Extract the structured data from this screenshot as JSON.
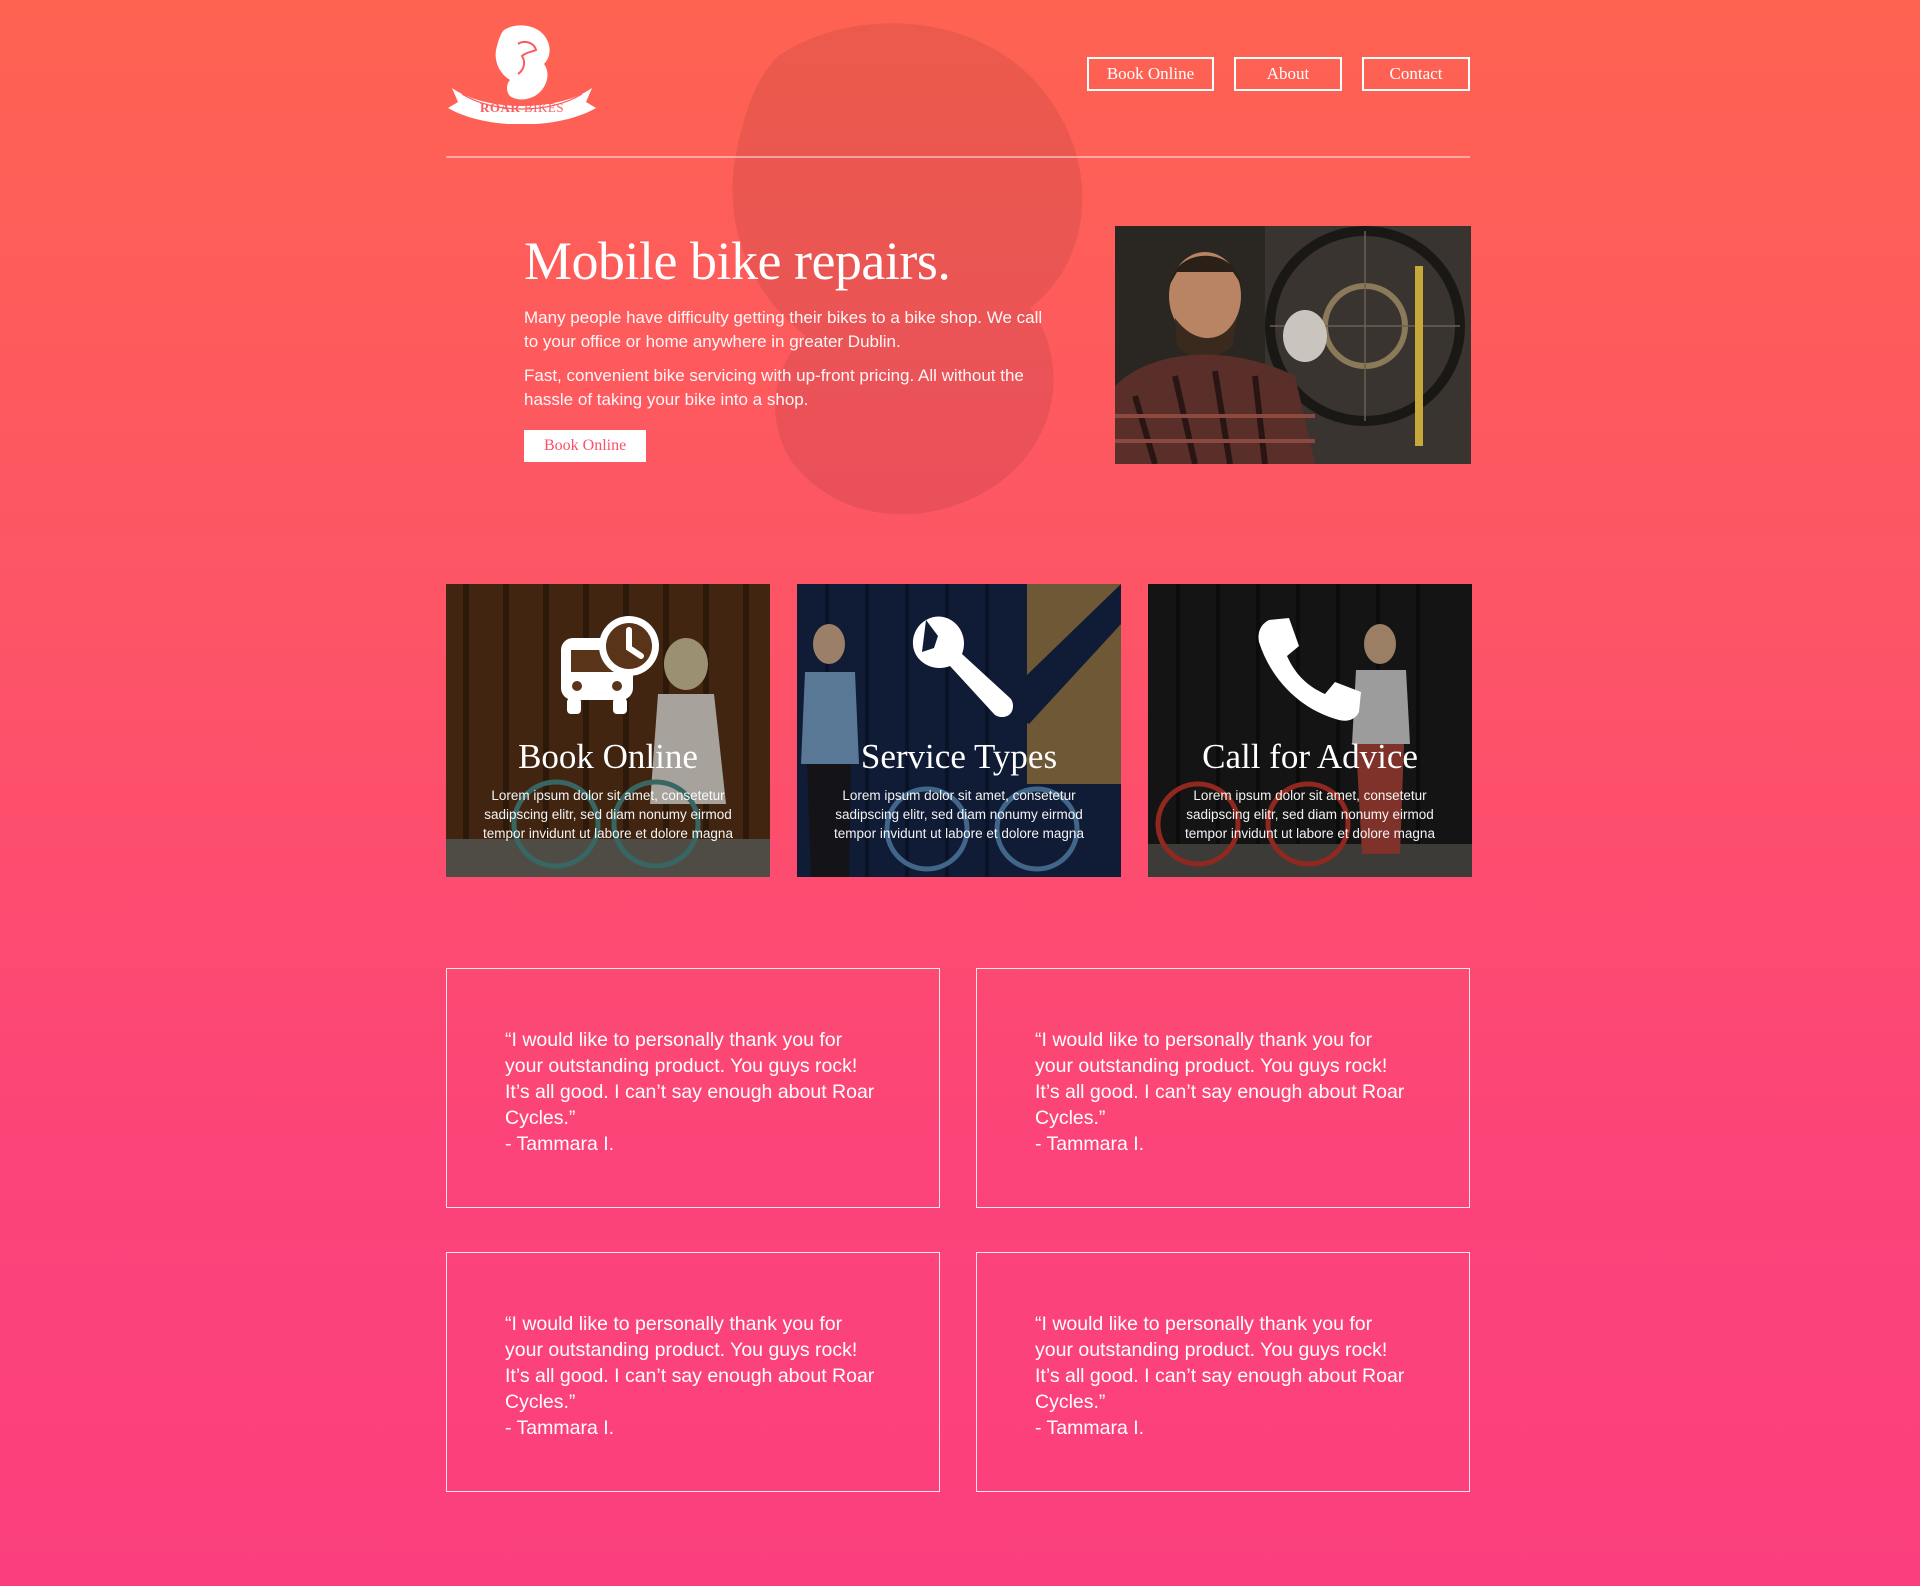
{
  "brand": {
    "logo_text_bold": "ROAR",
    "logo_text_light": "BIKES"
  },
  "nav": {
    "items": [
      {
        "label": "Book Online"
      },
      {
        "label": "About"
      },
      {
        "label": "Contact"
      }
    ]
  },
  "hero": {
    "title": "Mobile bike repairs.",
    "paragraph_1": "Many people have difficulty getting their bikes to a bike shop. We call to your office or home anywhere in greater Dublin.",
    "paragraph_2": "Fast, convenient bike servicing with up-front pricing. All without the hassle of taking your bike into a shop.",
    "cta_label": "Book Online"
  },
  "services": [
    {
      "title": "Book Online",
      "icon": "bus-clock-icon",
      "description": "Lorem ipsum dolor sit amet, consetetur sadipscing elitr, sed diam nonumy eirmod tempor invidunt ut labore et dolore magna"
    },
    {
      "title": "Service Types",
      "icon": "wrench-icon",
      "description": "Lorem ipsum dolor sit amet, consetetur sadipscing elitr, sed diam nonumy eirmod tempor invidunt ut labore et dolore magna"
    },
    {
      "title": "Call for Advice",
      "icon": "phone-icon",
      "description": "Lorem ipsum dolor sit amet, consetetur sadipscing elitr, sed diam nonumy eirmod tempor invidunt ut labore et dolore magna"
    }
  ],
  "testimonials": [
    {
      "quote": "“I would like to personally thank you for your outstanding product. You guys rock! It’s all good. I can’t say enough about Roar Cycles.”",
      "author": "- Tammara I."
    },
    {
      "quote": "“I would like to personally thank you for your outstanding product. You guys rock! It’s all good. I can’t say enough about Roar Cycles.”",
      "author": "- Tammara I."
    },
    {
      "quote": "“I would like to personally thank you for your outstanding product. You guys rock! It’s all good. I can’t say enough about Roar Cycles.”",
      "author": "- Tammara I."
    },
    {
      "quote": "“I would like to personally thank you for your outstanding product. You guys rock! It’s all good. I can’t say enough about Roar Cycles.”",
      "author": "- Tammara I."
    }
  ],
  "colors": {
    "gradient_top": "#fe6351",
    "gradient_bottom": "#fb3f7e",
    "accent": "#fc5068",
    "text": "#ffffff"
  }
}
